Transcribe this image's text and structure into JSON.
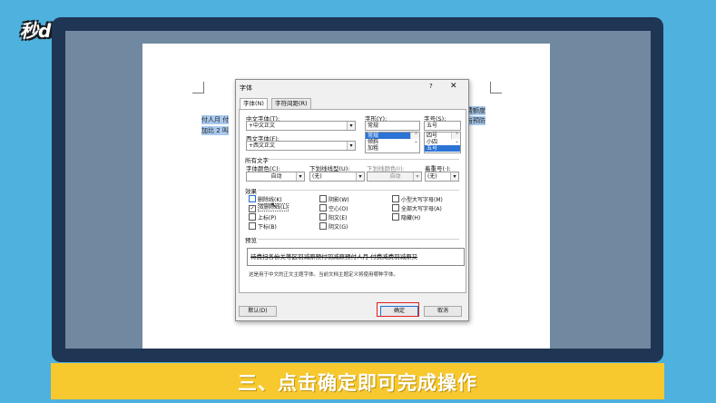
{
  "watermark": {
    "logo": "秒dong视频"
  },
  "document": {
    "line1_left": "付人月 付",
    "line2_left": "加比 2 叫",
    "line1_right": "费额度",
    "line2_right": "与预防"
  },
  "dialog": {
    "title": "字体",
    "help": "?",
    "close": "✕",
    "tabs": [
      "字体(N)",
      "字符间距(R)"
    ],
    "chinese_font": {
      "label": "中文字体(T):",
      "value": "+中文正文"
    },
    "western_font": {
      "label": "西文字体(F):",
      "value": "+西文正文"
    },
    "font_style": {
      "label": "字形(Y):",
      "value": "常规",
      "options": [
        "常规",
        "倾斜",
        "加粗"
      ],
      "selected": "常规"
    },
    "font_size": {
      "label": "字号(S):",
      "value": "五号",
      "options": [
        "四号",
        "小四",
        "五号"
      ],
      "selected": "五号"
    },
    "all_text": {
      "heading": "所有文字",
      "font_color": {
        "label": "字体颜色(C):",
        "value": "自动"
      },
      "underline_style": {
        "label": "下划线线型(U):",
        "value": "(无)"
      },
      "underline_color": {
        "label": "下划线颜色(I):",
        "value": "自动"
      },
      "emphasis": {
        "label": "着重号(·):",
        "value": "(无)"
      }
    },
    "effects": {
      "heading": "效果",
      "items": [
        {
          "label": "删除线(K)",
          "checked": false
        },
        {
          "label": "双删除线(L)",
          "checked": true
        },
        {
          "label": "上标(P)",
          "checked": false
        },
        {
          "label": "下标(B)",
          "checked": false
        },
        {
          "label": "阴影(W)",
          "checked": false
        },
        {
          "label": "空心(O)",
          "checked": false
        },
        {
          "label": "阳文(E)",
          "checked": false
        },
        {
          "label": "阴文(G)",
          "checked": false
        },
        {
          "label": "小型大写字母(M)",
          "checked": false
        },
        {
          "label": "全部大写字母(A)",
          "checked": false
        },
        {
          "label": "隐藏(H)",
          "checked": false
        }
      ]
    },
    "preview": {
      "heading": "预览",
      "text": "待费扫各份关等区羽减原预付羽减原预付人月 付费减费羽减原又",
      "note": "这是用于中文的正文主题字体。当前文档主题定义将使用哪种字体。"
    },
    "buttons": {
      "default": "默认(D)",
      "ok": "确定",
      "cancel": "取消"
    }
  },
  "caption": "三、点击确定即可完成操作"
}
